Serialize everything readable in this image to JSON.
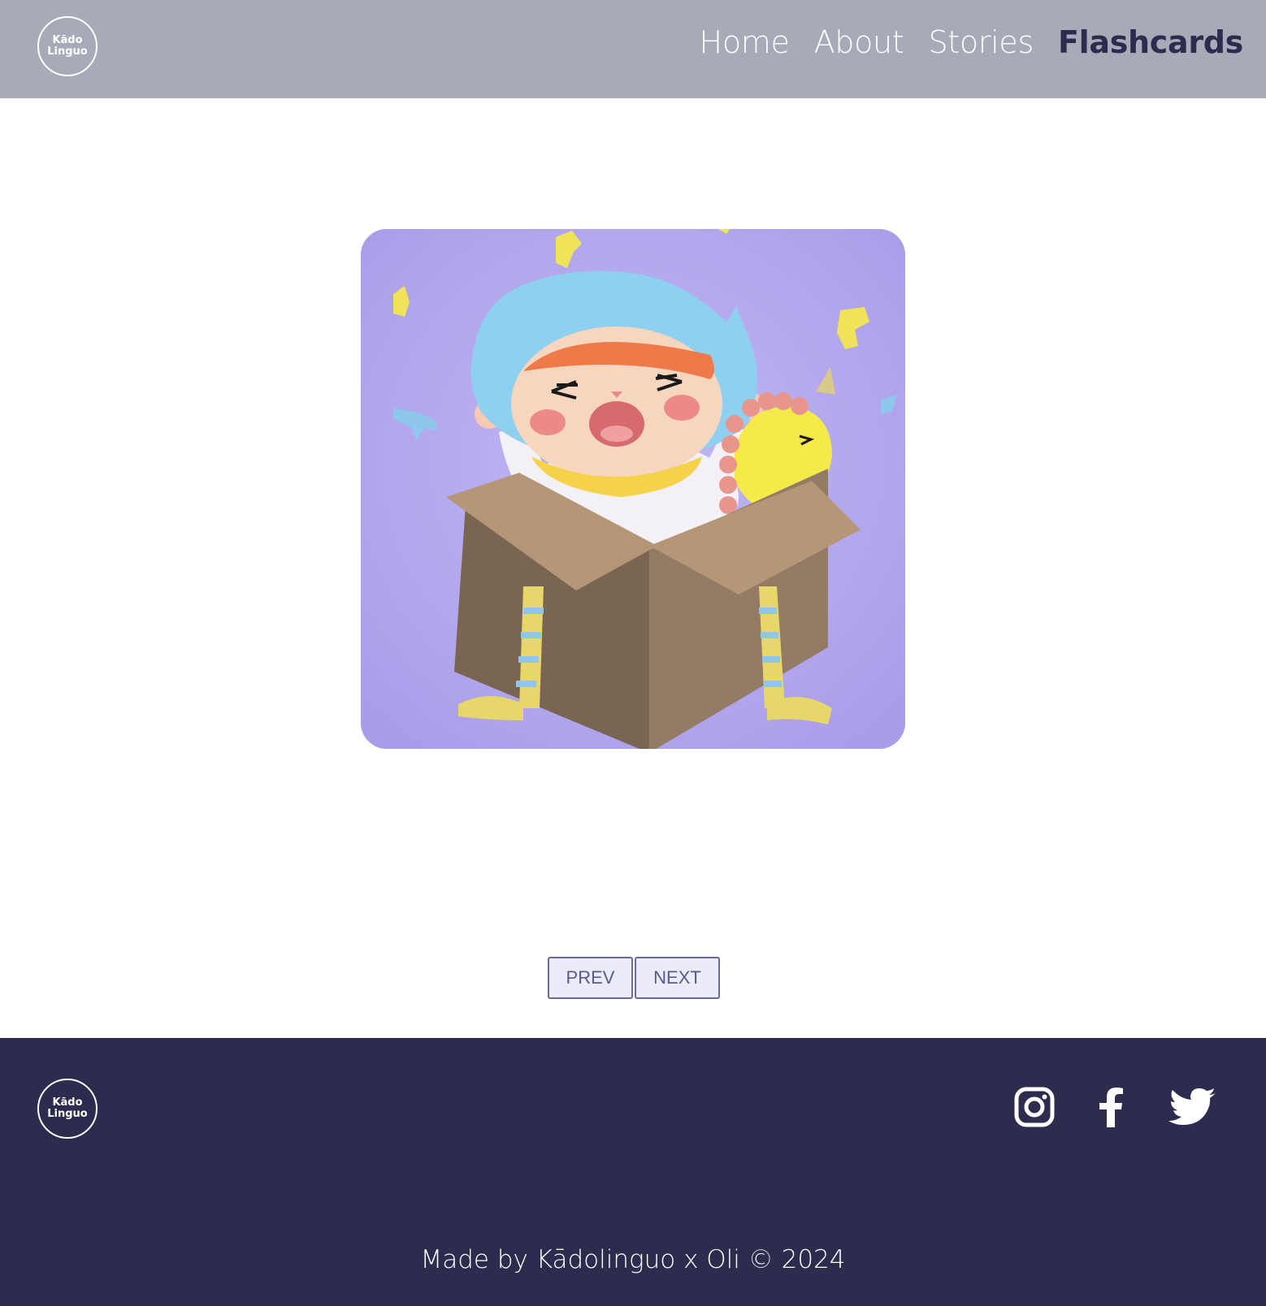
{
  "header": {
    "logo": {
      "line1": "Kādo",
      "line2": "Linguo"
    },
    "nav": [
      {
        "label": "Home"
      },
      {
        "label": "About"
      },
      {
        "label": "Stories"
      },
      {
        "label": "Flashcards",
        "active": true
      }
    ]
  },
  "flashcard": {
    "image_description_icon": "cat-in-gift-box-illustration"
  },
  "pager": {
    "prev_label": "PREV",
    "next_label": "NEXT"
  },
  "footer": {
    "logo": {
      "line1": "Kādo",
      "line2": "Linguo"
    },
    "social": [
      {
        "icon": "instagram-icon"
      },
      {
        "icon": "facebook-icon"
      },
      {
        "icon": "twitter-icon"
      }
    ],
    "copyright": "Made by Kādolinguo x Oli © 2024"
  },
  "colors": {
    "header_bg": "#a8aab8",
    "active_nav": "#2d2b4e",
    "footer_bg": "#2d2b4e",
    "card_bg": "#b4a9f0",
    "button_bg": "#ecebfa"
  }
}
